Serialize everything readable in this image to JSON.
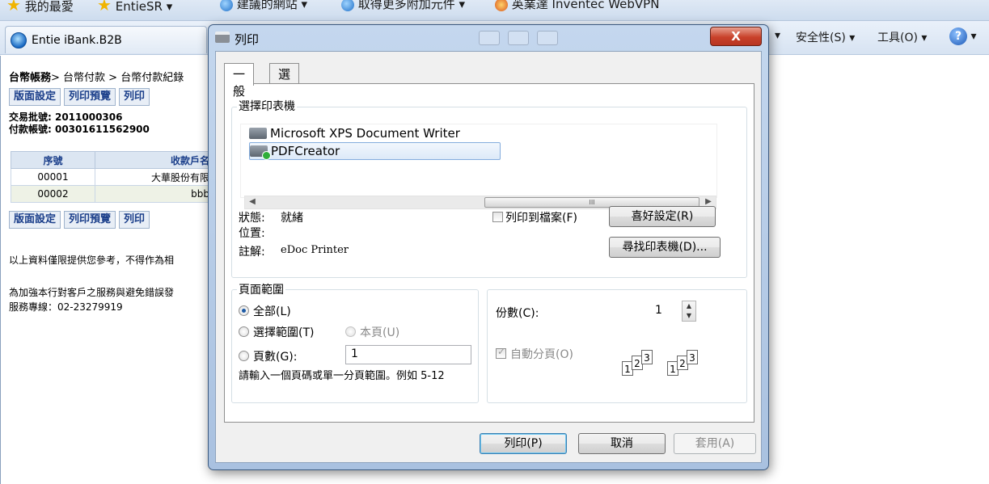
{
  "browser": {
    "favorites": [
      "我的最愛",
      "EntieSR ▾",
      "建議的網站 ▾",
      "取得更多附加元件 ▾",
      "英業達 Inventec WebVPN"
    ],
    "tab_title": "Entie iBank.B2B",
    "commands": [
      "安全性(S) ▾",
      "工具(O) ▾"
    ],
    "help_label": "?"
  },
  "page": {
    "breadcrumb_bold": "台幣帳務",
    "breadcrumb_rest": "> 台幣付款 > 台幣付款紀錄",
    "buttons": [
      "版面設定",
      "列印預覽",
      "列印"
    ],
    "batch_no": "交易批號: 2011000306",
    "account_no": "付款帳號: 00301611562900",
    "table": {
      "headers": [
        "序號",
        "收款戶名"
      ],
      "rows": [
        [
          "00001",
          "大華股份有限"
        ],
        [
          "00002",
          "bbb"
        ]
      ]
    },
    "note1": "以上資料僅限提供您參考，不得作為相",
    "note2": "為加強本行對客戶之服務與避免錯誤發",
    "hotline": "服務專線：02-23279919"
  },
  "dialog": {
    "title": "列印",
    "close_label": "X",
    "tabs": [
      "一般",
      "選項"
    ],
    "select_printer_label": "選擇印表機",
    "printers": [
      "Microsoft XPS Document Writer",
      "PDFCreator"
    ],
    "scroll_thumb": "III",
    "status_label": "狀態:",
    "status_value": "就緒",
    "location_label": "位置:",
    "comment_label": "註解:",
    "comment_value": "eDoc Printer",
    "print_to_file": "列印到檔案(F)",
    "preferences_button": "喜好設定(R)",
    "find_printer_button": "尋找印表機(D)...",
    "page_range_label": "頁面範圍",
    "range_all": "全部(L)",
    "range_selection": "選擇範圍(T)",
    "range_current": "本頁(U)",
    "range_pages": "頁數(G):",
    "pages_value": "1",
    "range_hint": "請輸入一個頁碼或單一分頁範圍。例如 5-12",
    "copies_label": "份數(C):",
    "copies_value": "1",
    "collate_label": "自動分頁(O)",
    "collate_digits": [
      "1",
      "2",
      "3"
    ],
    "print_button": "列印(P)",
    "cancel_button": "取消",
    "apply_button": "套用(A)"
  }
}
